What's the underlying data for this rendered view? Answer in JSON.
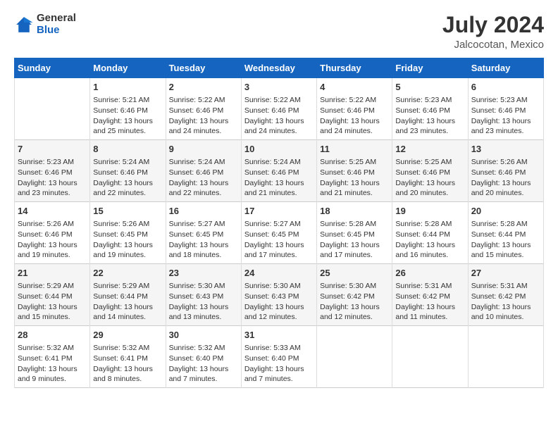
{
  "header": {
    "logo_general": "General",
    "logo_blue": "Blue",
    "title": "July 2024",
    "subtitle": "Jalcocotan, Mexico"
  },
  "columns": [
    "Sunday",
    "Monday",
    "Tuesday",
    "Wednesday",
    "Thursday",
    "Friday",
    "Saturday"
  ],
  "weeks": [
    {
      "cells": [
        {
          "day": "",
          "sunrise": "",
          "sunset": "",
          "daylight": ""
        },
        {
          "day": "1",
          "sunrise": "Sunrise: 5:21 AM",
          "sunset": "Sunset: 6:46 PM",
          "daylight": "Daylight: 13 hours and 25 minutes."
        },
        {
          "day": "2",
          "sunrise": "Sunrise: 5:22 AM",
          "sunset": "Sunset: 6:46 PM",
          "daylight": "Daylight: 13 hours and 24 minutes."
        },
        {
          "day": "3",
          "sunrise": "Sunrise: 5:22 AM",
          "sunset": "Sunset: 6:46 PM",
          "daylight": "Daylight: 13 hours and 24 minutes."
        },
        {
          "day": "4",
          "sunrise": "Sunrise: 5:22 AM",
          "sunset": "Sunset: 6:46 PM",
          "daylight": "Daylight: 13 hours and 24 minutes."
        },
        {
          "day": "5",
          "sunrise": "Sunrise: 5:23 AM",
          "sunset": "Sunset: 6:46 PM",
          "daylight": "Daylight: 13 hours and 23 minutes."
        },
        {
          "day": "6",
          "sunrise": "Sunrise: 5:23 AM",
          "sunset": "Sunset: 6:46 PM",
          "daylight": "Daylight: 13 hours and 23 minutes."
        }
      ]
    },
    {
      "cells": [
        {
          "day": "7",
          "sunrise": "Sunrise: 5:23 AM",
          "sunset": "Sunset: 6:46 PM",
          "daylight": "Daylight: 13 hours and 23 minutes."
        },
        {
          "day": "8",
          "sunrise": "Sunrise: 5:24 AM",
          "sunset": "Sunset: 6:46 PM",
          "daylight": "Daylight: 13 hours and 22 minutes."
        },
        {
          "day": "9",
          "sunrise": "Sunrise: 5:24 AM",
          "sunset": "Sunset: 6:46 PM",
          "daylight": "Daylight: 13 hours and 22 minutes."
        },
        {
          "day": "10",
          "sunrise": "Sunrise: 5:24 AM",
          "sunset": "Sunset: 6:46 PM",
          "daylight": "Daylight: 13 hours and 21 minutes."
        },
        {
          "day": "11",
          "sunrise": "Sunrise: 5:25 AM",
          "sunset": "Sunset: 6:46 PM",
          "daylight": "Daylight: 13 hours and 21 minutes."
        },
        {
          "day": "12",
          "sunrise": "Sunrise: 5:25 AM",
          "sunset": "Sunset: 6:46 PM",
          "daylight": "Daylight: 13 hours and 20 minutes."
        },
        {
          "day": "13",
          "sunrise": "Sunrise: 5:26 AM",
          "sunset": "Sunset: 6:46 PM",
          "daylight": "Daylight: 13 hours and 20 minutes."
        }
      ]
    },
    {
      "cells": [
        {
          "day": "14",
          "sunrise": "Sunrise: 5:26 AM",
          "sunset": "Sunset: 6:46 PM",
          "daylight": "Daylight: 13 hours and 19 minutes."
        },
        {
          "day": "15",
          "sunrise": "Sunrise: 5:26 AM",
          "sunset": "Sunset: 6:45 PM",
          "daylight": "Daylight: 13 hours and 19 minutes."
        },
        {
          "day": "16",
          "sunrise": "Sunrise: 5:27 AM",
          "sunset": "Sunset: 6:45 PM",
          "daylight": "Daylight: 13 hours and 18 minutes."
        },
        {
          "day": "17",
          "sunrise": "Sunrise: 5:27 AM",
          "sunset": "Sunset: 6:45 PM",
          "daylight": "Daylight: 13 hours and 17 minutes."
        },
        {
          "day": "18",
          "sunrise": "Sunrise: 5:28 AM",
          "sunset": "Sunset: 6:45 PM",
          "daylight": "Daylight: 13 hours and 17 minutes."
        },
        {
          "day": "19",
          "sunrise": "Sunrise: 5:28 AM",
          "sunset": "Sunset: 6:44 PM",
          "daylight": "Daylight: 13 hours and 16 minutes."
        },
        {
          "day": "20",
          "sunrise": "Sunrise: 5:28 AM",
          "sunset": "Sunset: 6:44 PM",
          "daylight": "Daylight: 13 hours and 15 minutes."
        }
      ]
    },
    {
      "cells": [
        {
          "day": "21",
          "sunrise": "Sunrise: 5:29 AM",
          "sunset": "Sunset: 6:44 PM",
          "daylight": "Daylight: 13 hours and 15 minutes."
        },
        {
          "day": "22",
          "sunrise": "Sunrise: 5:29 AM",
          "sunset": "Sunset: 6:44 PM",
          "daylight": "Daylight: 13 hours and 14 minutes."
        },
        {
          "day": "23",
          "sunrise": "Sunrise: 5:30 AM",
          "sunset": "Sunset: 6:43 PM",
          "daylight": "Daylight: 13 hours and 13 minutes."
        },
        {
          "day": "24",
          "sunrise": "Sunrise: 5:30 AM",
          "sunset": "Sunset: 6:43 PM",
          "daylight": "Daylight: 13 hours and 12 minutes."
        },
        {
          "day": "25",
          "sunrise": "Sunrise: 5:30 AM",
          "sunset": "Sunset: 6:42 PM",
          "daylight": "Daylight: 13 hours and 12 minutes."
        },
        {
          "day": "26",
          "sunrise": "Sunrise: 5:31 AM",
          "sunset": "Sunset: 6:42 PM",
          "daylight": "Daylight: 13 hours and 11 minutes."
        },
        {
          "day": "27",
          "sunrise": "Sunrise: 5:31 AM",
          "sunset": "Sunset: 6:42 PM",
          "daylight": "Daylight: 13 hours and 10 minutes."
        }
      ]
    },
    {
      "cells": [
        {
          "day": "28",
          "sunrise": "Sunrise: 5:32 AM",
          "sunset": "Sunset: 6:41 PM",
          "daylight": "Daylight: 13 hours and 9 minutes."
        },
        {
          "day": "29",
          "sunrise": "Sunrise: 5:32 AM",
          "sunset": "Sunset: 6:41 PM",
          "daylight": "Daylight: 13 hours and 8 minutes."
        },
        {
          "day": "30",
          "sunrise": "Sunrise: 5:32 AM",
          "sunset": "Sunset: 6:40 PM",
          "daylight": "Daylight: 13 hours and 7 minutes."
        },
        {
          "day": "31",
          "sunrise": "Sunrise: 5:33 AM",
          "sunset": "Sunset: 6:40 PM",
          "daylight": "Daylight: 13 hours and 7 minutes."
        },
        {
          "day": "",
          "sunrise": "",
          "sunset": "",
          "daylight": ""
        },
        {
          "day": "",
          "sunrise": "",
          "sunset": "",
          "daylight": ""
        },
        {
          "day": "",
          "sunrise": "",
          "sunset": "",
          "daylight": ""
        }
      ]
    }
  ]
}
